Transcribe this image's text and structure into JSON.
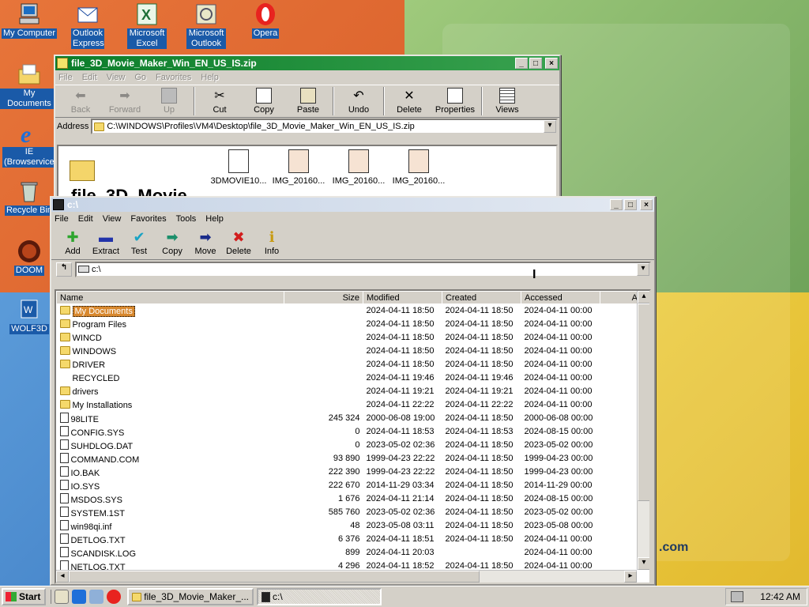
{
  "desktop": {
    "icons": [
      {
        "name": "my-computer-icon",
        "label": "My Computer"
      },
      {
        "name": "outlook-express-icon",
        "label": "Outlook Express"
      },
      {
        "name": "microsoft-excel-icon",
        "label": "Microsoft Excel"
      },
      {
        "name": "microsoft-outlook-icon",
        "label": "Microsoft Outlook"
      },
      {
        "name": "opera-icon",
        "label": "Opera"
      },
      {
        "name": "my-documents-icon",
        "label": "My Documents"
      },
      {
        "name": "ie-icon",
        "label": "IE (Browservice)"
      },
      {
        "name": "recycle-bin-icon",
        "label": "Recycle Bin"
      },
      {
        "name": "doom-icon",
        "label": "DOOM"
      },
      {
        "name": "wolf3d-icon",
        "label": "WOLF3D"
      }
    ],
    "wallpaper_text": ".com"
  },
  "explorer": {
    "title": "file_3D_Movie_Maker_Win_EN_US_IS.zip",
    "menu": [
      "File",
      "Edit",
      "View",
      "Go",
      "Favorites",
      "Help"
    ],
    "toolbar": [
      "Back",
      "Forward",
      "Up",
      "Cut",
      "Copy",
      "Paste",
      "Undo",
      "Delete",
      "Properties",
      "Views"
    ],
    "address_label": "Address",
    "address": "C:\\WINDOWS\\Profiles\\VM4\\Desktop\\file_3D_Movie_Maker_Win_EN_US_IS.zip",
    "files": [
      "3DMOVIE10...",
      "IMG_20160...",
      "IMG_20160...",
      "IMG_20160..."
    ],
    "big_title": "file_3D_Movie"
  },
  "zipwin": {
    "title": "c:\\",
    "menu": [
      "File",
      "Edit",
      "View",
      "Favorites",
      "Tools",
      "Help"
    ],
    "toolbar": [
      "Add",
      "Extract",
      "Test",
      "Copy",
      "Move",
      "Delete",
      "Info"
    ],
    "path": "c:\\",
    "columns": [
      "Name",
      "Size",
      "Modified",
      "Created",
      "Accessed",
      "A"
    ],
    "rows": [
      {
        "icon": "folder",
        "name": "My Documents",
        "size": "",
        "modified": "2024-04-11 18:50",
        "created": "2024-04-11 18:50",
        "accessed": "2024-04-11 00:00"
      },
      {
        "icon": "folder",
        "name": "Program Files",
        "size": "",
        "modified": "2024-04-11 18:50",
        "created": "2024-04-11 18:50",
        "accessed": "2024-04-11 00:00"
      },
      {
        "icon": "folder",
        "name": "WINCD",
        "size": "",
        "modified": "2024-04-11 18:50",
        "created": "2024-04-11 18:50",
        "accessed": "2024-04-11 00:00"
      },
      {
        "icon": "folder",
        "name": "WINDOWS",
        "size": "",
        "modified": "2024-04-11 18:50",
        "created": "2024-04-11 18:50",
        "accessed": "2024-04-11 00:00"
      },
      {
        "icon": "folder",
        "name": "DRIVER",
        "size": "",
        "modified": "2024-04-11 18:50",
        "created": "2024-04-11 18:50",
        "accessed": "2024-04-11 00:00"
      },
      {
        "icon": "none",
        "name": "RECYCLED",
        "size": "",
        "modified": "2024-04-11 19:46",
        "created": "2024-04-11 19:46",
        "accessed": "2024-04-11 00:00"
      },
      {
        "icon": "folder",
        "name": "drivers",
        "size": "",
        "modified": "2024-04-11 19:21",
        "created": "2024-04-11 19:21",
        "accessed": "2024-04-11 00:00"
      },
      {
        "icon": "folder",
        "name": "My Installations",
        "size": "",
        "modified": "2024-04-11 22:22",
        "created": "2024-04-11 22:22",
        "accessed": "2024-04-11 00:00"
      },
      {
        "icon": "file",
        "name": "98LITE",
        "size": "245 324",
        "modified": "2000-06-08 19:00",
        "created": "2024-04-11 18:50",
        "accessed": "2000-06-08 00:00"
      },
      {
        "icon": "file",
        "name": "CONFIG.SYS",
        "size": "0",
        "modified": "2024-04-11 18:53",
        "created": "2024-04-11 18:53",
        "accessed": "2024-08-15 00:00"
      },
      {
        "icon": "file",
        "name": "SUHDLOG.DAT",
        "size": "0",
        "modified": "2023-05-02 02:36",
        "created": "2024-04-11 18:50",
        "accessed": "2023-05-02 00:00"
      },
      {
        "icon": "file",
        "name": "COMMAND.COM",
        "size": "93 890",
        "modified": "1999-04-23 22:22",
        "created": "2024-04-11 18:50",
        "accessed": "1999-04-23 00:00"
      },
      {
        "icon": "file",
        "name": "IO.BAK",
        "size": "222 390",
        "modified": "1999-04-23 22:22",
        "created": "2024-04-11 18:50",
        "accessed": "1999-04-23 00:00"
      },
      {
        "icon": "file",
        "name": "IO.SYS",
        "size": "222 670",
        "modified": "2014-11-29 03:34",
        "created": "2024-04-11 18:50",
        "accessed": "2014-11-29 00:00"
      },
      {
        "icon": "file",
        "name": "MSDOS.SYS",
        "size": "1 676",
        "modified": "2024-04-11 21:14",
        "created": "2024-04-11 18:50",
        "accessed": "2024-08-15 00:00"
      },
      {
        "icon": "file",
        "name": "SYSTEM.1ST",
        "size": "585 760",
        "modified": "2023-05-02 02:36",
        "created": "2024-04-11 18:50",
        "accessed": "2023-05-02 00:00"
      },
      {
        "icon": "file",
        "name": "win98qi.inf",
        "size": "48",
        "modified": "2023-05-08 03:11",
        "created": "2024-04-11 18:50",
        "accessed": "2023-05-08 00:00"
      },
      {
        "icon": "file",
        "name": "DETLOG.TXT",
        "size": "6 376",
        "modified": "2024-04-11 18:51",
        "created": "2024-04-11 18:50",
        "accessed": "2024-04-11 00:00"
      },
      {
        "icon": "file",
        "name": "SCANDISK.LOG",
        "size": "899",
        "modified": "2024-04-11 20:03",
        "created": "",
        "accessed": "2024-04-11 00:00"
      },
      {
        "icon": "file",
        "name": "NETLOG.TXT",
        "size": "4 296",
        "modified": "2024-04-11 18:52",
        "created": "2024-04-11 18:50",
        "accessed": "2024-04-11 00:00"
      }
    ]
  },
  "taskbar": {
    "start_label": "Start",
    "quicklaunch": [
      "show-desktop-icon",
      "ie-icon",
      "outlook-icon",
      "opera-icon"
    ],
    "tasks": [
      "file_3D_Movie_Maker_...",
      "c:\\"
    ],
    "clock": "12:42 AM"
  }
}
